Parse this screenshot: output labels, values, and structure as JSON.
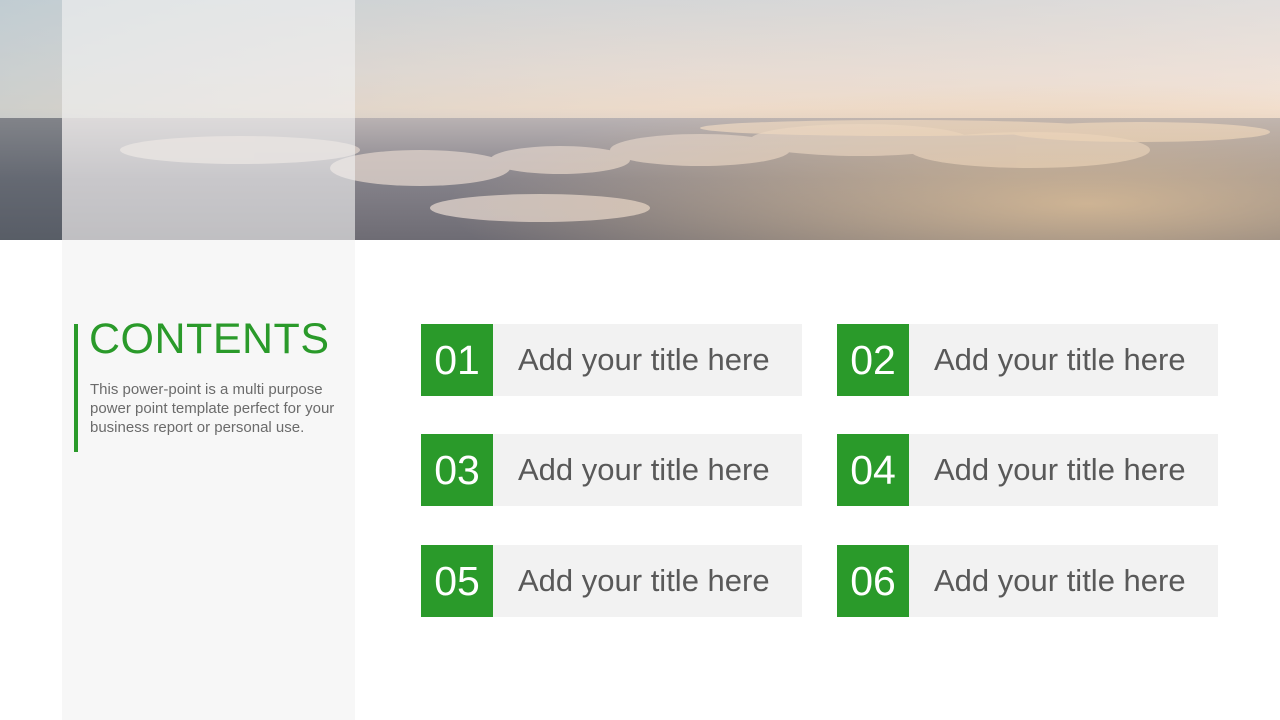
{
  "slide": {
    "heading": "CONTENTS",
    "description": "This power-point is a multi purpose power point template perfect for your business report or personal use.",
    "accent_color": "#2a9a2a",
    "items": [
      {
        "number": "01",
        "title": "Add your title here"
      },
      {
        "number": "02",
        "title": "Add your title here"
      },
      {
        "number": "03",
        "title": "Add your title here"
      },
      {
        "number": "04",
        "title": "Add your title here"
      },
      {
        "number": "05",
        "title": "Add your title here"
      },
      {
        "number": "06",
        "title": "Add your title here"
      }
    ]
  }
}
